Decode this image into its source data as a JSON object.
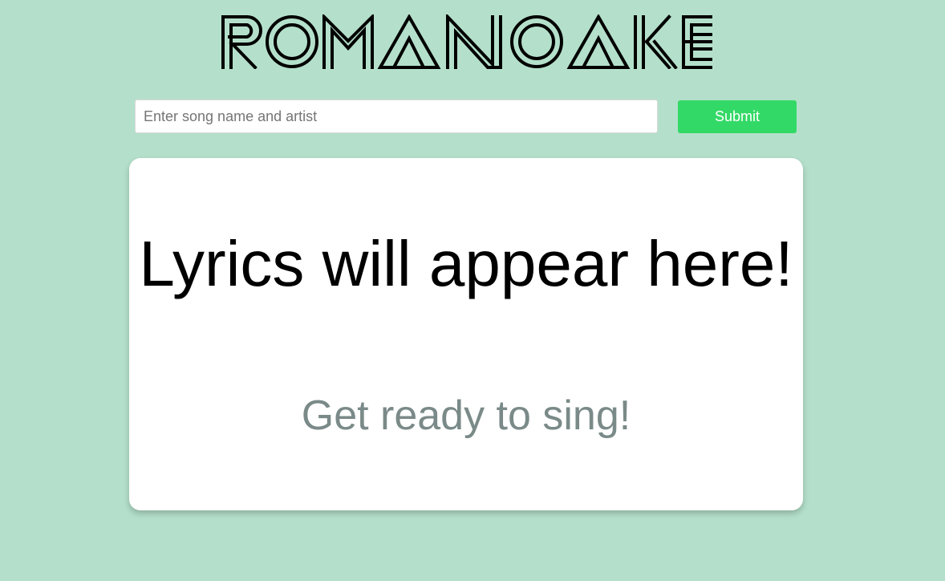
{
  "app": {
    "logo_text": "ROMANOAKE"
  },
  "search": {
    "placeholder": "Enter song name and artist",
    "value": "",
    "submit_label": "Submit"
  },
  "lyrics": {
    "heading": "Lyrics will appear here!",
    "subheading": "Get ready to sing!"
  },
  "colors": {
    "background": "#b4e0cb",
    "submit": "#33d966",
    "card": "#ffffff",
    "subheading_text": "#7a8a88"
  }
}
